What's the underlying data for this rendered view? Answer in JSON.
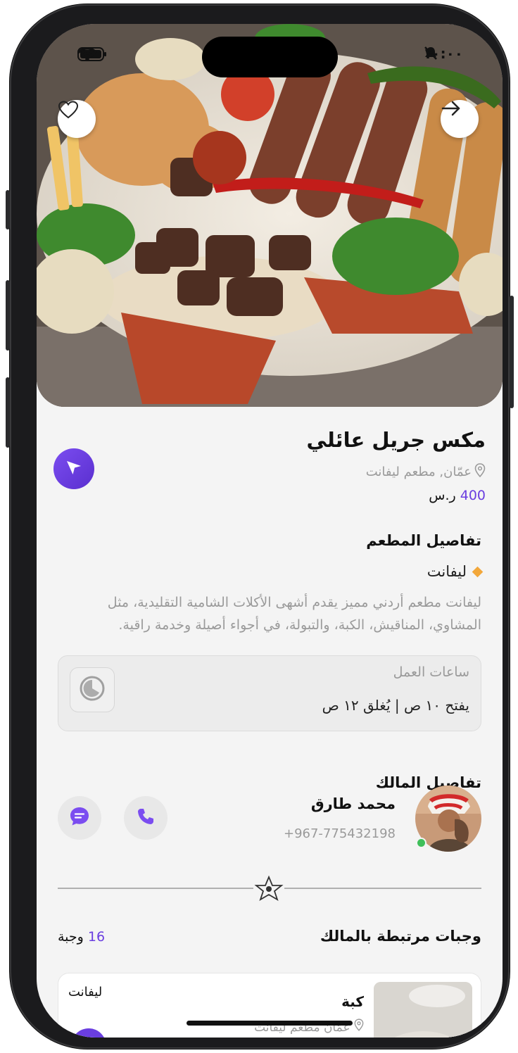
{
  "status_bar": {
    "time": "١٠:٠٠"
  },
  "dish": {
    "title": "مكس جريل عائلي",
    "location": "عمّان, مطعم ليفانت",
    "price_value": "400",
    "price_currency": "ر.س"
  },
  "restaurant_section": {
    "heading": "تفاصيل المطعم",
    "name": "ليفانت",
    "description": "ليفانت مطعم أردني مميز يقدم أشهى الأكلات الشامية التقليدية، مثل المشاوي، المناقيش، الكبة، والتبولة، في أجواء أصيلة وخدمة راقية."
  },
  "working_hours": {
    "label": "ساعات العمل",
    "value": "يفتح ١٠ ص | يُغلق ١٢ ص"
  },
  "owner_section": {
    "heading": "تفاصيل المالك",
    "name": "محمد طارق",
    "phone": "+967-775432198"
  },
  "related_meals": {
    "heading": "وجبات مرتبطة بالمالك",
    "count_value": "16",
    "count_unit": "وجبة",
    "items": [
      {
        "name": "كبة",
        "location": "عمّان مطعم ليفانت",
        "tag": "ليفانت"
      }
    ]
  },
  "icons": {
    "favorite": "heart-icon",
    "share": "arrow-right-icon",
    "navigate": "navigation-arrow-icon",
    "location": "location-pin-icon",
    "clock": "clock-icon",
    "call": "phone-icon",
    "chat": "chat-icon",
    "divider": "star-icon"
  },
  "colors": {
    "accent": "#6a3ee0",
    "diamond": "#f2a73a",
    "online": "#3fbf5a",
    "muted_text": "#9a9a9a"
  }
}
